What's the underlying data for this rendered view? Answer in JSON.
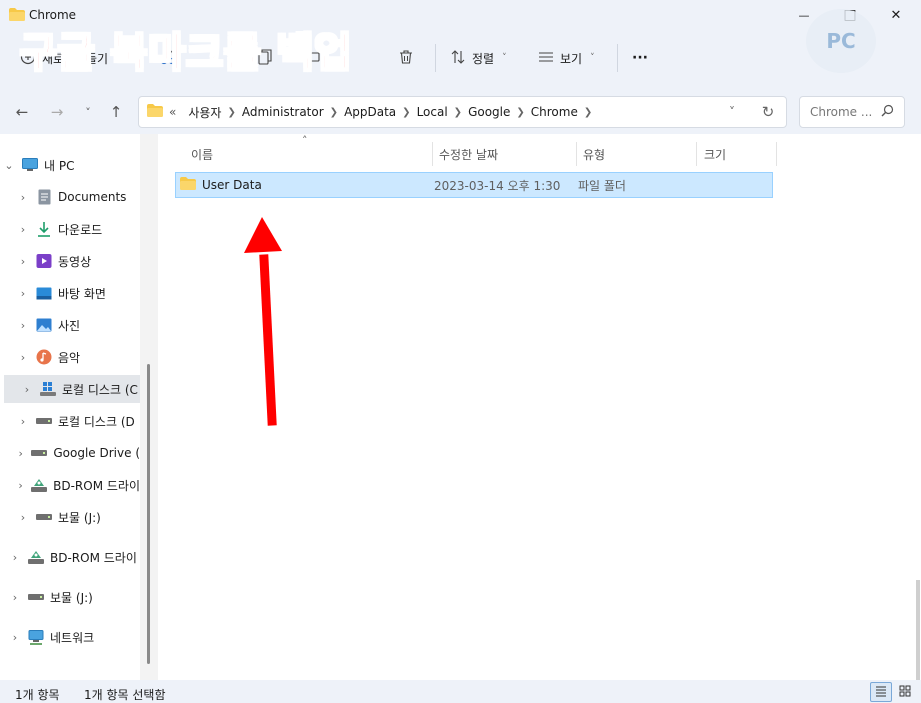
{
  "window": {
    "title": "Chrome",
    "minimize_label": "—",
    "maximize_label": "□",
    "close_label": "✕"
  },
  "overlay": {
    "caption": "구글 북마크를 백업",
    "caption_color": "#ff1a1a",
    "logo_text": "PC"
  },
  "toolbar": {
    "new_label": "새로",
    "open_label": "들기",
    "sort_label": "정렬",
    "view_label": "보기",
    "more_label": "···"
  },
  "navigation": {
    "back_label": "←",
    "forward_label": "→",
    "recent_label": "˅",
    "up_label": "↑",
    "overflow_label": "«",
    "breadcrumbs": [
      "사용자",
      "Administrator",
      "AppData",
      "Local",
      "Google",
      "Chrome"
    ],
    "dropdown_label": "˅",
    "refresh_label": "↻",
    "search_placeholder": "Chrome ..."
  },
  "sidebar": {
    "items": [
      {
        "label": "내 PC",
        "icon": "computer-icon",
        "expanded": true
      },
      {
        "label": "Documents",
        "icon": "documents-icon"
      },
      {
        "label": "다운로드",
        "icon": "download-icon"
      },
      {
        "label": "동영상",
        "icon": "video-icon"
      },
      {
        "label": "바탕 화면",
        "icon": "desktop-icon"
      },
      {
        "label": "사진",
        "icon": "pictures-icon"
      },
      {
        "label": "음악",
        "icon": "music-icon"
      },
      {
        "label": "로컬 디스크 (C",
        "icon": "windows-drive-icon",
        "selected": true
      },
      {
        "label": "로컬 디스크 (D",
        "icon": "drive-icon"
      },
      {
        "label": "Google Drive (",
        "icon": "drive-icon"
      },
      {
        "label": "BD-ROM 드라이",
        "icon": "bd-rom-icon"
      },
      {
        "label": "보물 (J:)",
        "icon": "drive-icon"
      },
      {
        "label": "BD-ROM 드라이",
        "icon": "bd-rom-icon"
      },
      {
        "label": "보물 (J:)",
        "icon": "drive-icon"
      },
      {
        "label": "네트워크",
        "icon": "network-icon"
      }
    ]
  },
  "file_list": {
    "sort_indicator": "˄",
    "columns": [
      "이름",
      "수정한 날짜",
      "유형",
      "크기"
    ],
    "rows": [
      {
        "name": "User Data",
        "modified": "2023-03-14 오후 1:30",
        "type": "파일 폴더",
        "size": ""
      }
    ]
  },
  "status": {
    "item_count": "1개 항목",
    "selection": "1개 항목 선택함"
  },
  "colors": {
    "selection_bg": "#cce8ff",
    "selection_border": "#99d1ff",
    "arrow": "#ff0000",
    "folder": "#f7c948"
  }
}
